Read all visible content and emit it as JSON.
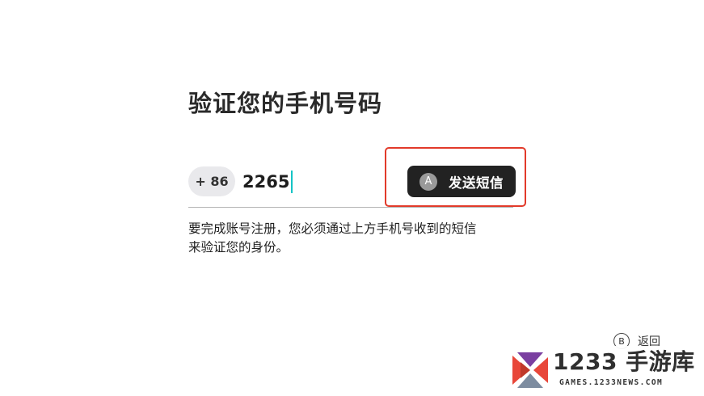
{
  "page": {
    "title": "验证您的手机号码"
  },
  "phone": {
    "country_code": "+ 86",
    "value": "2265"
  },
  "send_button": {
    "key_hint": "A",
    "label": "发送短信"
  },
  "description": {
    "line1": "要完成账号注册，您必须通过上方手机号收到的短信",
    "line2": "来验证您的身份。"
  },
  "footer": {
    "back_key": "B",
    "back_label": "返回"
  },
  "watermark": {
    "title": "1233 手游库",
    "url": "GAMES.1233NEWS.COM"
  },
  "colors": {
    "highlight_box": "#e23a2a",
    "caret": "#15c4c6",
    "button_bg": "#222222"
  }
}
